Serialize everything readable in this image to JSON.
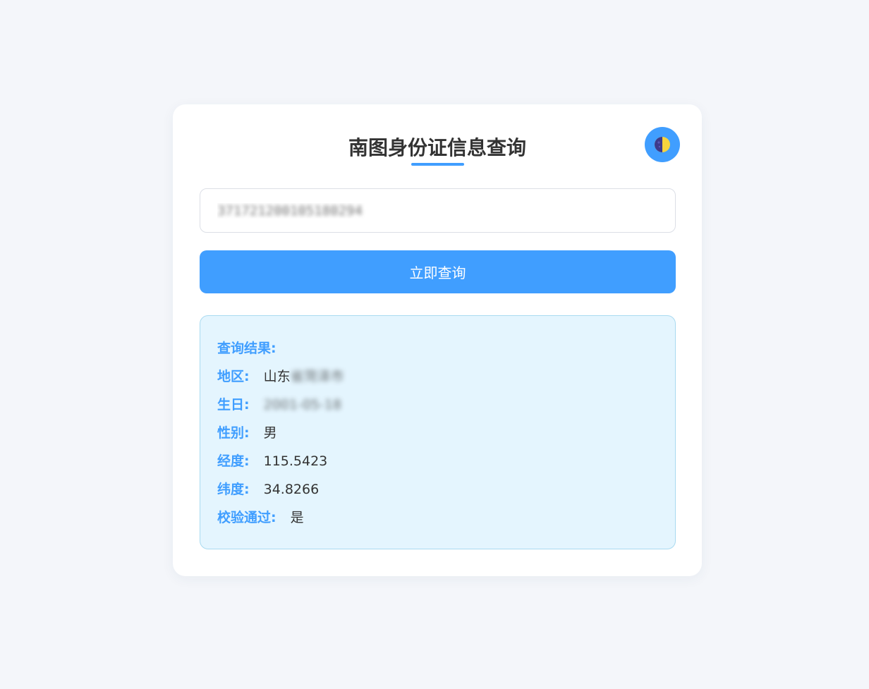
{
  "header": {
    "title": "南图身份证信息查询",
    "theme_toggle_icon": "half-moon-icon"
  },
  "search": {
    "value": "371721200105180294",
    "button_label": "立即查询"
  },
  "result": {
    "title": "查询结果:",
    "region_label": "地区:",
    "region_value_visible": "山东",
    "region_value_masked": "省菏泽市",
    "birthday_label": "生日:",
    "birthday_value": "2001-05-18",
    "gender_label": "性别:",
    "gender_value": "男",
    "longitude_label": "经度:",
    "longitude_value": "115.5423",
    "latitude_label": "纬度:",
    "latitude_value": "34.8266",
    "verified_label": "校验通过:",
    "verified_value": "是"
  },
  "colors": {
    "accent": "#409eff",
    "background": "#f4f6fa",
    "result_background": "#e4f5fe",
    "result_border": "#a9daf0",
    "toggle_moon_dark": "#3d3a8c",
    "toggle_moon_light": "#f5d33e"
  }
}
